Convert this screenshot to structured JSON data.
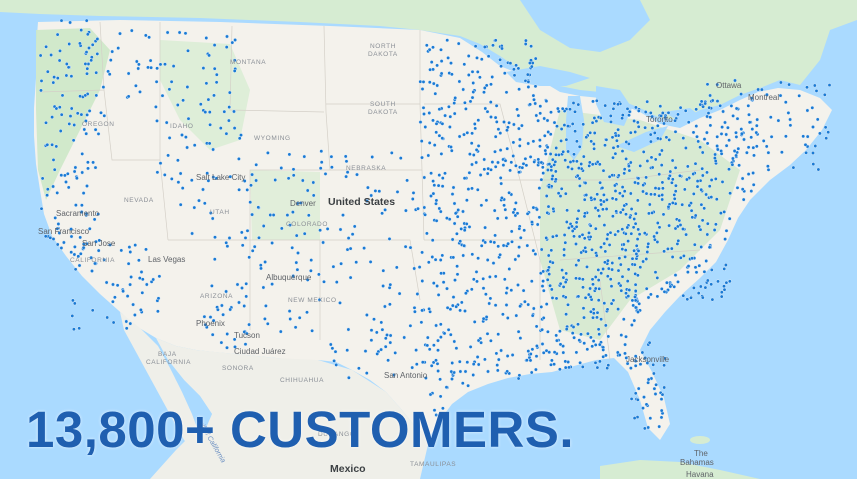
{
  "headline": "13,800+ CUSTOMERS.",
  "colors": {
    "water": "#aadaff",
    "land": "#f1f3f4",
    "forest": "#cde8c8",
    "marker": "#1a7ad4",
    "headline": "#1f5fb0"
  },
  "labels": {
    "country_us": "United States",
    "country_mx": "Mexico",
    "montana": "MONTANA",
    "wyoming": "WYOMING",
    "idaho": "IDAHO",
    "oregon": "OREGON",
    "nevada": "NEVADA",
    "north_dakota": "NORTH\nDAKOTA",
    "south_dakota": "SOUTH\nDAKOTA",
    "nebraska": "NEBRASKA",
    "colorado": "COLORADO",
    "arizona": "ARIZONA",
    "new_mexico": "NEW MEXICO",
    "utah": "UTAH",
    "chihuahua": "CHIHUAHUA",
    "sonora": "SONORA",
    "baja": "BAJA\nCALIFORNIA",
    "california": "CALIFORNIA",
    "durango": "DURANGO",
    "tamaulipas": "TAMAULIPAS",
    "ottawa": "Ottawa",
    "montreal": "Montreal",
    "toronto": "Toronto",
    "las_vegas": "Las Vegas",
    "albuquerque": "Albuquerque",
    "tucson": "Tucson",
    "ciudad_juarez": "Ciudad Juárez",
    "phoenix": "Phoenix",
    "san_antonio": "San Antonio",
    "jacksonville": "Jacksonville",
    "the_bahamas": "The\nBahamas",
    "havana": "Havana",
    "denver": "Denver",
    "salt_lake": "Salt Lake City",
    "san_jose": "San Jose",
    "sacramento": "Sacramento",
    "san_fran": "San Francisco",
    "gulf_california": "Gulf of California"
  }
}
